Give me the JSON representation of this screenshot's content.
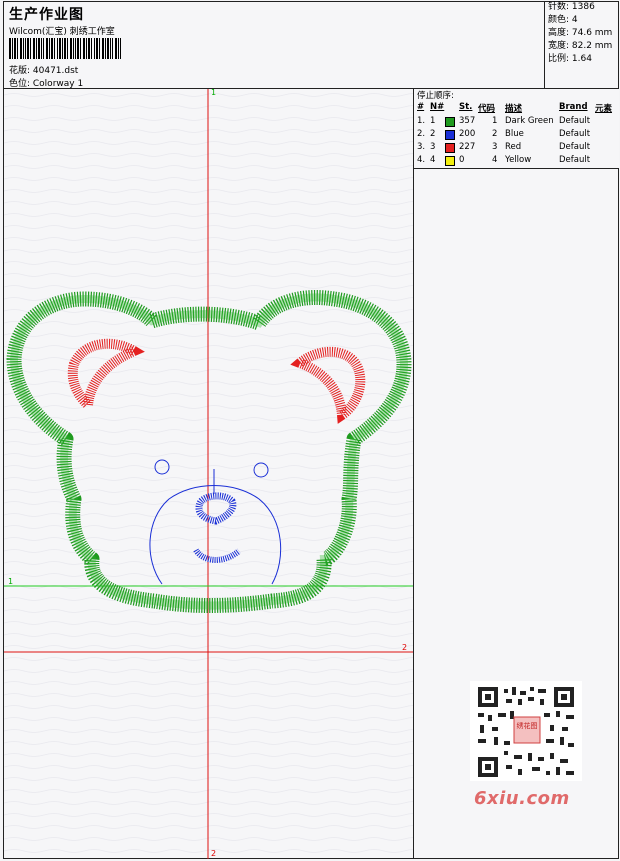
{
  "header": {
    "title": "生产作业图",
    "company": "Wilcom(汇宝) 刺绣工作室",
    "design_label": "花版: 40471.dst",
    "colorway_label": "色位: Colorway 1"
  },
  "stats": {
    "stitches": "针数: 1386",
    "colors": "颜色: 4",
    "height": "高度: 74.6 mm",
    "width": "宽度: 82.2 mm",
    "scale": "比例: 1.64"
  },
  "stop_sequence": {
    "title": "停止顺序:",
    "headers": {
      "hash": "#",
      "no": "N#",
      "st": "St.",
      "code": "代码",
      "desc": "描述",
      "brand": "Brand",
      "element": "元素"
    },
    "rows": [
      {
        "idx": "1.",
        "n": "1",
        "color": "#1f9a1f",
        "st": "357",
        "code": "1",
        "desc": "Dark Green",
        "brand": "Default"
      },
      {
        "idx": "2.",
        "n": "2",
        "color": "#1a2fd6",
        "st": "200",
        "code": "2",
        "desc": "Blue",
        "brand": "Default"
      },
      {
        "idx": "3.",
        "n": "3",
        "color": "#e42020",
        "st": "227",
        "code": "3",
        "desc": "Red",
        "brand": "Default"
      },
      {
        "idx": "4.",
        "n": "4",
        "color": "#f2ee10",
        "st": "0",
        "code": "4",
        "desc": "Yellow",
        "brand": "Default"
      }
    ]
  },
  "canvas": {
    "axis_top": "1",
    "axis_bottom": "2",
    "axis_left": "1",
    "axis_right": "2",
    "axis_red": "#dd1111",
    "axis_green": "#22cc22"
  },
  "watermark": {
    "text": "6xiu.com",
    "qr_badge": "绣花图",
    "color": "#e06a6a"
  }
}
